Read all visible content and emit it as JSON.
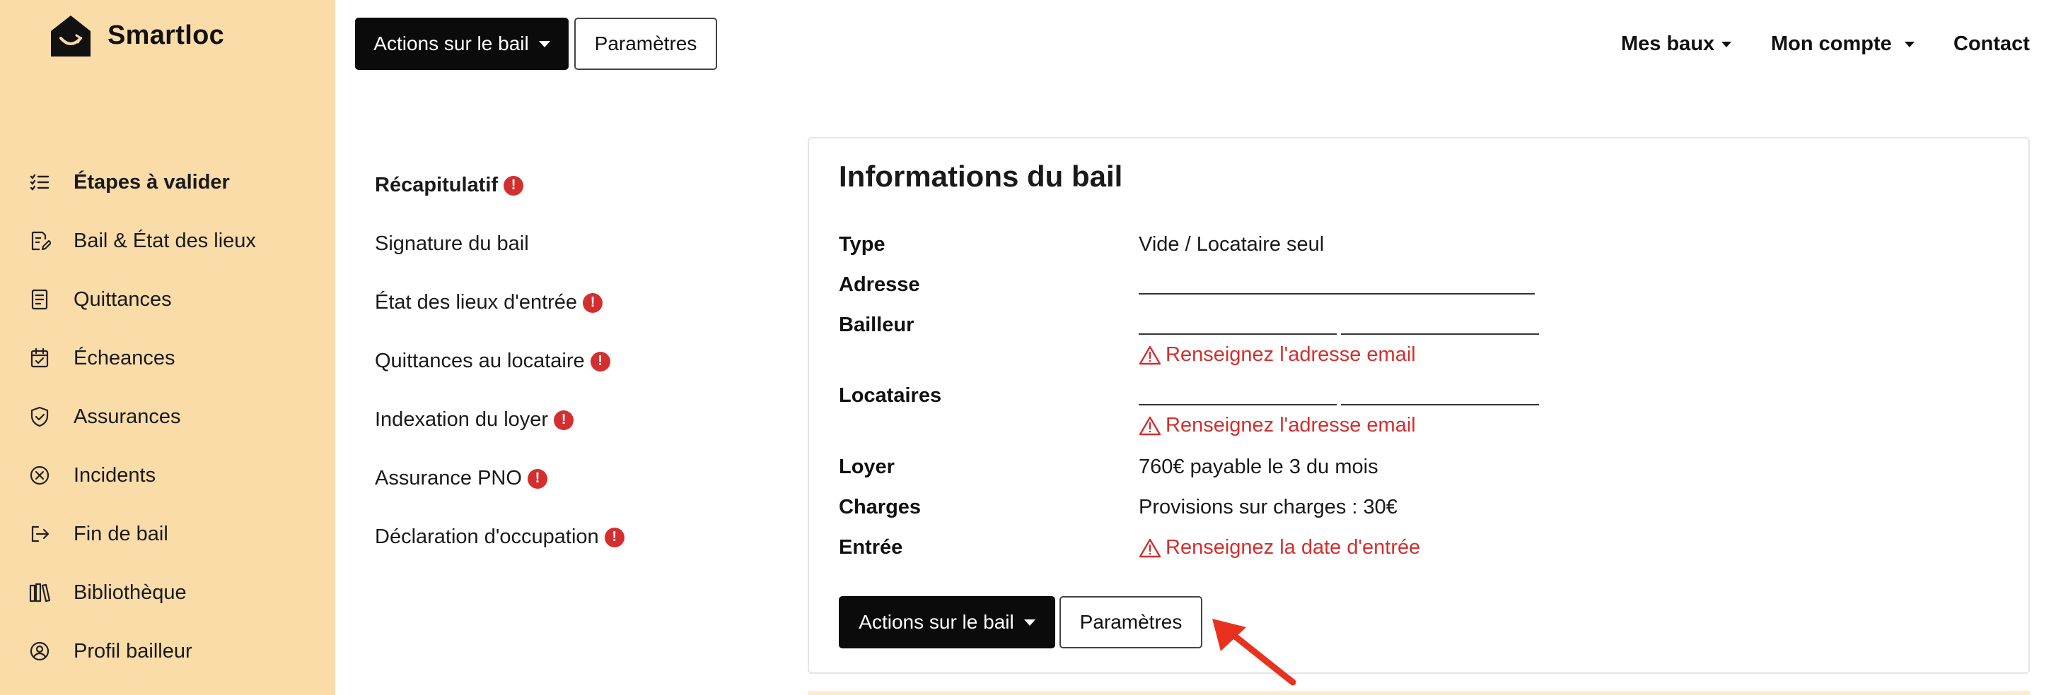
{
  "brand": {
    "name": "Smartloc",
    "icon": "house-smile-logo"
  },
  "sidebar": {
    "items": [
      {
        "label": "Étapes à valider",
        "icon": "checklist-icon",
        "active": true
      },
      {
        "label": "Bail & État des lieux",
        "icon": "edit-document-icon",
        "active": false
      },
      {
        "label": "Quittances",
        "icon": "receipt-icon",
        "active": false
      },
      {
        "label": "Écheances",
        "icon": "calendar-check-icon",
        "active": false
      },
      {
        "label": "Assurances",
        "icon": "shield-check-icon",
        "active": false
      },
      {
        "label": "Incidents",
        "icon": "circle-x-icon",
        "active": false
      },
      {
        "label": "Fin de bail",
        "icon": "exit-icon",
        "active": false
      },
      {
        "label": "Bibliothèque",
        "icon": "books-icon",
        "active": false
      },
      {
        "label": "Profil bailleur",
        "icon": "user-circle-icon",
        "active": false
      }
    ]
  },
  "toolbar": {
    "actions_label": "Actions sur le bail",
    "settings_label": "Paramètres"
  },
  "topnav": {
    "leases": "Mes baux",
    "account": "Mon compte",
    "contact": "Contact"
  },
  "steps": [
    {
      "label": "Récapitulatif",
      "alert": true,
      "active": true
    },
    {
      "label": "Signature du bail",
      "alert": false,
      "active": false
    },
    {
      "label": "État des lieux d'entrée",
      "alert": true,
      "active": false
    },
    {
      "label": "Quittances au locataire",
      "alert": true,
      "active": false
    },
    {
      "label": "Indexation du loyer",
      "alert": true,
      "active": false
    },
    {
      "label": "Assurance PNO",
      "alert": true,
      "active": false
    },
    {
      "label": "Déclaration d'occupation",
      "alert": true,
      "active": false
    }
  ],
  "alert_symbol": "!",
  "card": {
    "title": "Informations du bail",
    "rows": {
      "type_label": "Type",
      "type_value": "Vide / Locataire seul",
      "address_label": "Adresse",
      "landlord_label": "Bailleur",
      "landlord_warning": "Renseignez l'adresse email",
      "tenants_label": "Locataires",
      "tenants_warning": "Renseignez l'adresse email",
      "rent_label": "Loyer",
      "rent_value": "760€ payable le 3 du mois",
      "charges_label": "Charges",
      "charges_value": "Provisions sur charges : 30€",
      "entry_label": "Entrée",
      "entry_warning": "Renseignez la date d'entrée"
    },
    "actions_label": "Actions sur le bail",
    "settings_label": "Paramètres"
  },
  "colors": {
    "sidebar_bg": "#fadca9",
    "warning": "#d32f2f",
    "primary_button": "#0b0b0b",
    "annotation_arrow": "#e8321f"
  }
}
